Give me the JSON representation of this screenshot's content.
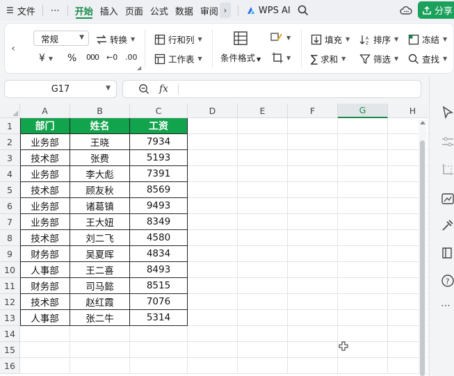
{
  "menu": {
    "items": [
      "文件",
      "⋯",
      "开始",
      "插入",
      "页面",
      "公式",
      "数据",
      "审阅"
    ],
    "active": "开始",
    "more_arrow": "›",
    "wps_ai": "WPS AI",
    "share": "分享"
  },
  "ribbon": {
    "number_format": "常规",
    "convert": "转换",
    "row_col": "行和列",
    "worksheet": "工作表",
    "cond_format": "条件格式",
    "fill": "填充",
    "sort": "排序",
    "freeze": "冻结",
    "sum": "求和",
    "filter": "筛选",
    "find": "查找",
    "currency_glyph": "¥",
    "percent_glyph": "%",
    "thousands_glyph": "000",
    "dec_inc_glyph": "←0",
    "dec_dec_glyph": ".00",
    "left_arrow": "‹"
  },
  "formula_bar": {
    "cell_ref": "G17",
    "fx": "fx",
    "value": ""
  },
  "sheet": {
    "columns": [
      "A",
      "B",
      "C",
      "D",
      "E",
      "F",
      "G",
      "H"
    ],
    "selected_column": "G",
    "rows": [
      "1",
      "2",
      "3",
      "4",
      "5",
      "6",
      "7",
      "8",
      "9",
      "10",
      "11",
      "12",
      "13",
      "14",
      "15",
      "16"
    ],
    "table_header": [
      "部门",
      "姓名",
      "工资"
    ],
    "table_rows": [
      [
        "业务部",
        "王晓",
        "7934"
      ],
      [
        "技术部",
        "张费",
        "5193"
      ],
      [
        "业务部",
        "李大彪",
        "7391"
      ],
      [
        "技术部",
        "顾友秋",
        "8569"
      ],
      [
        "业务部",
        "诸葛镇",
        "9493"
      ],
      [
        "业务部",
        "王大妞",
        "8349"
      ],
      [
        "技术部",
        "刘二飞",
        "4580"
      ],
      [
        "财务部",
        "吴夏晖",
        "4834"
      ],
      [
        "人事部",
        "王二喜",
        "8493"
      ],
      [
        "财务部",
        "司马懿",
        "8515"
      ],
      [
        "技术部",
        "赵红霞",
        "7076"
      ],
      [
        "人事部",
        "张二牛",
        "5314"
      ]
    ],
    "header_color": "#12a34d"
  },
  "side_panel": {
    "more": "⋯"
  }
}
